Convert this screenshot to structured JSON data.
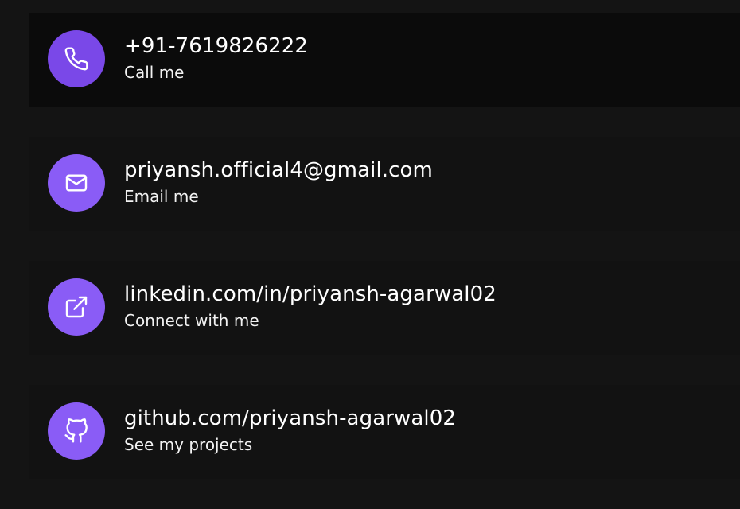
{
  "colors": {
    "background": "#141414",
    "card": "#121212",
    "card_active": "#0b0b0b",
    "accent": "#8a5cf6",
    "accent_dark": "#7a48e8",
    "text": "#ffffff"
  },
  "contacts": [
    {
      "value": "+91-7619826222",
      "caption": "Call me",
      "icon": "phone-icon"
    },
    {
      "value": "priyansh.official4@gmail.com",
      "caption": "Email me",
      "icon": "mail-icon"
    },
    {
      "value": "linkedin.com/in/priyansh-agarwal02",
      "caption": "Connect with me",
      "icon": "external-link-icon"
    },
    {
      "value": "github.com/priyansh-agarwal02",
      "caption": "See my projects",
      "icon": "github-icon"
    }
  ]
}
